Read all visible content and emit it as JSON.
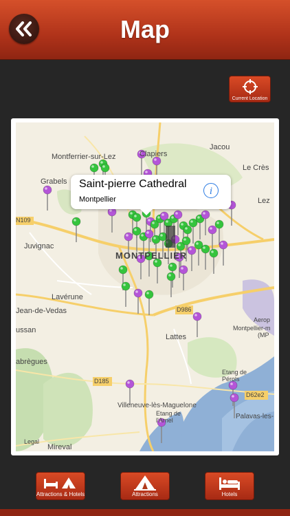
{
  "header": {
    "title": "Map",
    "back_icon": "double-chevron-left-icon"
  },
  "current_location": {
    "label": "Current Location",
    "icon": "crosshair-icon"
  },
  "map": {
    "places": {
      "montferrier": "Montferrier-sur-Lez",
      "grabels": "Grabels",
      "clapiers": "Clapiers",
      "jacou": "Jacou",
      "le_cres": "Le Crès",
      "lez": "Lez",
      "n109": "N109",
      "juvignac": "Juvignac",
      "montpellier": "MONTPELLIER",
      "laverune": "Lavérune",
      "jean_de_vedas": "Jean-de-Vedas",
      "saussan": "ussan",
      "d986": "D986",
      "aeroport": "Aerop",
      "montpellier_m": "Montpellier-m",
      "mp": "(MP",
      "lattes": "Lattes",
      "fabregues": "abrègues",
      "etang_perols": "Etang de Pérols",
      "d185": "D185",
      "d62e2": "D62e2",
      "villeneuve": "Villeneuve-lès-Maguelone",
      "etang_arnel": "Etang de l'Arnel",
      "palavas": "Palavas-les-",
      "mireval": "Mireval",
      "legal": "Legal"
    },
    "callout": {
      "title": "Saint-pierre Cathedral",
      "subtitle": "Montpellier",
      "info_icon": "info-icon"
    },
    "pin_colors": {
      "green": "#35c43d",
      "purple": "#b455d8"
    }
  },
  "tabs": [
    {
      "label": "Attractions & Hotels",
      "icon": "attractions-hotels-icon"
    },
    {
      "label": "Attractions",
      "icon": "tent-icon"
    },
    {
      "label": "Hotels",
      "icon": "bed-icon"
    }
  ]
}
